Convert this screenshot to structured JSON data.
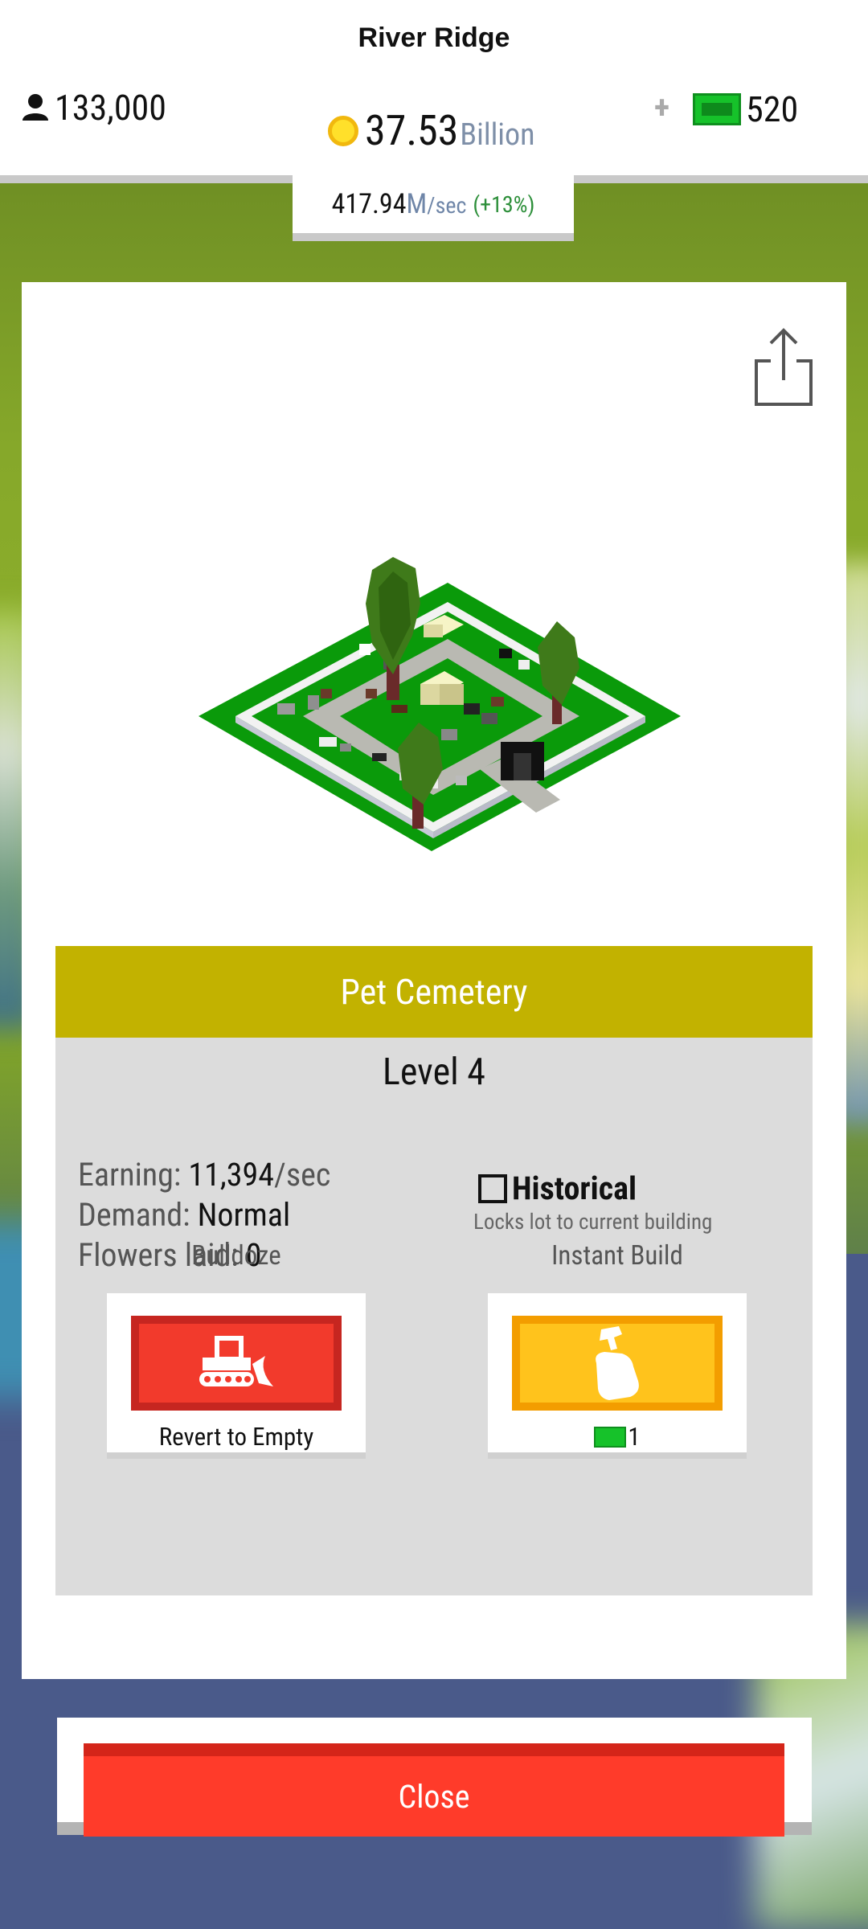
{
  "header": {
    "city_name": "River Ridge",
    "population": "133,000",
    "money_value": "37.53",
    "money_unit": "Billion",
    "plus_symbol": "+",
    "cash_count": "520",
    "rate_value": "417.94",
    "rate_unit_m": "M",
    "rate_unit_sec": "/sec",
    "rate_change": "(+13%)"
  },
  "building": {
    "name": "Pet Cemetery",
    "level": "Level 4",
    "earning_label": "Earning:",
    "earning_value": "11,394",
    "earning_unit": "/sec",
    "demand_label": "Demand:",
    "demand_value": "Normal",
    "flowers_label": "Flowers laid:",
    "flowers_value": "0",
    "historical_label": "Historical",
    "historical_desc": "Locks lot to current building",
    "historical_checked": false
  },
  "actions": {
    "bulldoze_title": "Bulldoze",
    "bulldoze_caption": "Revert to Empty",
    "instant_title": "Instant Build",
    "instant_cost": "1"
  },
  "close_label": "Close",
  "colors": {
    "name_bar": "#c2b200",
    "bulldoze": "#f23a2c",
    "instant": "#ffc31c",
    "close": "#ff3b2a",
    "cash": "#16c22a"
  },
  "icons": [
    "person-icon",
    "coin-icon",
    "cash-icon",
    "share-icon",
    "bulldozer-icon",
    "hammer-hand-icon"
  ]
}
